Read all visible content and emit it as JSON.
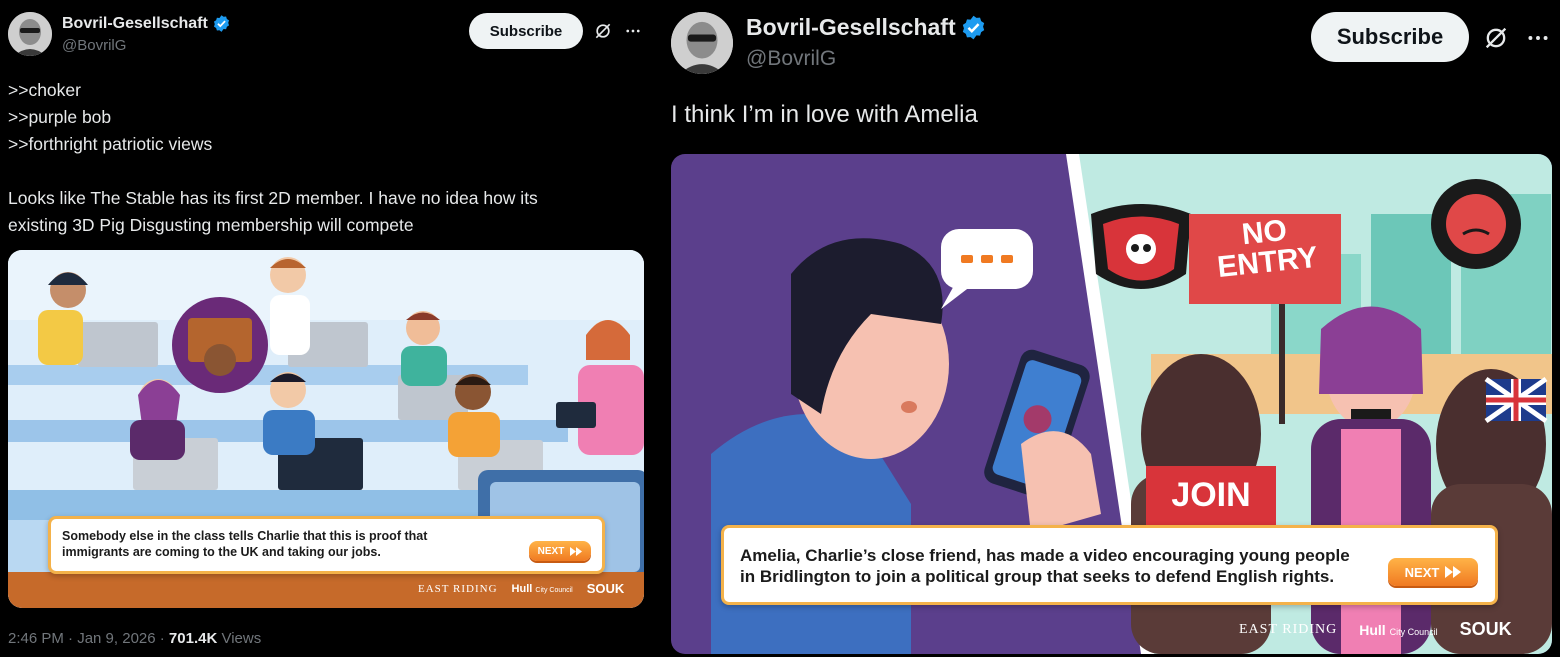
{
  "left_post": {
    "display_name": "Bovril-Gesellschaft",
    "handle": "@BovrilG",
    "subscribe_label": "Subscribe",
    "text": ">>choker\n>>purple bob\n>>forthright patriotic views\n\nLooks like The Stable has its first 2D member. I have no idea how its\nexisting 3D Pig Disgusting membership will compete",
    "image_caption": "Somebody else in the class tells Charlie that this is proof that\nimmigrants are coming to the UK and taking our jobs.",
    "next_label": "NEXT",
    "logo_east_riding": "EAST RIDING",
    "logo_hull": "Hull",
    "logo_hull_sub": "City Council",
    "logo_souk": "SOUK",
    "timestamp": "2:46 PM · Jan 9, 2026 · ",
    "views_count": "701.4K",
    "views_label": " Views"
  },
  "right_post": {
    "display_name": "Bovril-Gesellschaft",
    "handle": "@BovrilG",
    "subscribe_label": "Subscribe",
    "text": "I think I’m in love with Amelia",
    "sign_text_1": "NO",
    "sign_text_2": "ENTRY",
    "join_text": "JOIN",
    "image_caption": "Amelia, Charlie’s close friend, has made a video encouraging young people\nin Bridlington to join a political group that seeks to defend English rights.",
    "next_label": "NEXT",
    "logo_east_riding": "EAST RIDING",
    "logo_hull": "Hull",
    "logo_hull_sub": "City Council",
    "logo_souk": "SOUK"
  },
  "colors": {
    "background": "#000000",
    "text_primary": "#e7e9ea",
    "text_secondary": "#71767b",
    "verified_blue": "#1d9bf0",
    "subscribe_bg": "#eff3f4",
    "caption_border": "#f4b24a",
    "next_orange": "#f07a22"
  },
  "icons": [
    "verified-badge-icon",
    "grok-icon",
    "more-options-icon",
    "next-arrow-icon"
  ]
}
